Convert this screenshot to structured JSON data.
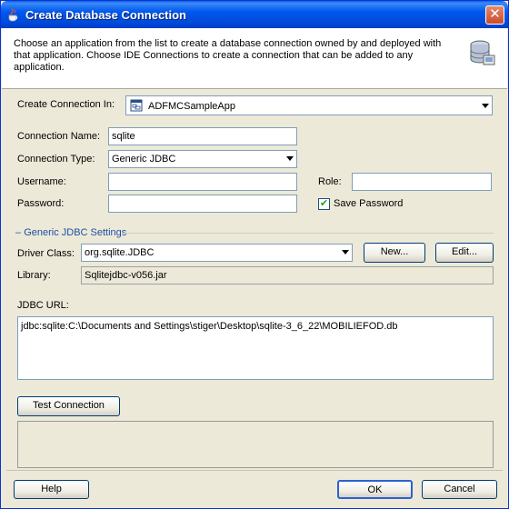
{
  "window": {
    "title": "Create Database Connection",
    "close": "✕"
  },
  "header": {
    "description": "Choose an application from the list to create a database connection owned by and deployed with that application. Choose IDE Connections to create a connection that can be added to any application."
  },
  "create_in": {
    "label": "Create Connection In:",
    "value": "ADFMCSampleApp"
  },
  "connection_name": {
    "label": "Connection Name:",
    "value": "sqlite"
  },
  "connection_type": {
    "label": "Connection Type:",
    "value": "Generic JDBC"
  },
  "username": {
    "label": "Username:",
    "value": ""
  },
  "password": {
    "label": "Password:",
    "value": ""
  },
  "role": {
    "label": "Role:",
    "value": ""
  },
  "save_password": {
    "label": "Save Password",
    "checked": true
  },
  "jdbc_settings": {
    "group_title": "Generic JDBC Settings",
    "driver_label": "Driver Class:",
    "driver_value": "org.sqlite.JDBC",
    "new_button": "New...",
    "edit_button": "Edit...",
    "library_label": "Library:",
    "library_value": "Sqlitejdbc-v056.jar"
  },
  "jdbc_url": {
    "label": "JDBC URL:",
    "value": "jdbc:sqlite:C:\\Documents and Settings\\stiger\\Desktop\\sqlite-3_6_22\\MOBILIEFOD.db"
  },
  "test_connection": {
    "label": "Test Connection",
    "status": ""
  },
  "footer": {
    "help": "Help",
    "ok": "OK",
    "cancel": "Cancel"
  }
}
